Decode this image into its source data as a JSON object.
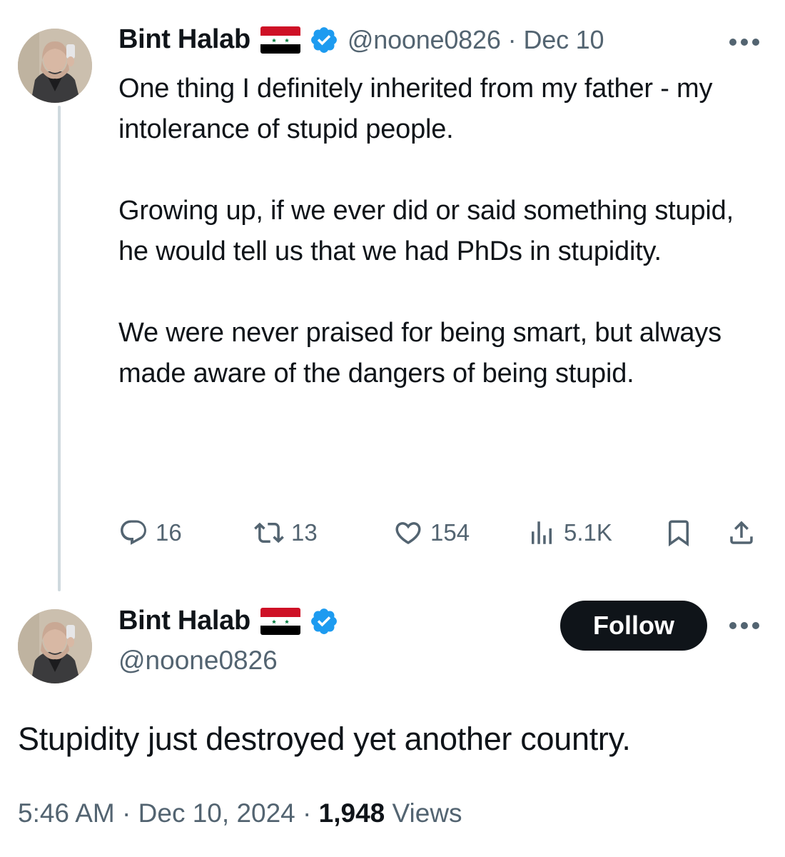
{
  "reply_tweet": {
    "author": {
      "display_name": "Bint Halab",
      "flag_icon": "syria-flag-icon",
      "verified_icon": "verified-badge-icon",
      "handle": "@noone0826"
    },
    "separator": "·",
    "date": "Dec 10",
    "more_icon": "more-horizontal-icon",
    "text_paragraphs": [
      "One thing I definitely inherited from my father - my intolerance of stupid people.",
      "Growing up, if we ever did or said something stupid, he would tell us that we had PhDs in stupidity.",
      "We were never praised for being smart, but always made aware of the dangers of being stupid."
    ],
    "actions": {
      "replies": "16",
      "reposts": "13",
      "likes": "154",
      "views": "5.1K"
    }
  },
  "main_tweet": {
    "author": {
      "display_name": "Bint Halab",
      "handle": "@noone0826"
    },
    "follow_label": "Follow",
    "text": "Stupidity just destroyed yet another country.",
    "meta": {
      "time": "5:46 AM",
      "separator": "·",
      "date": "Dec 10, 2024",
      "views_count": "1,948",
      "views_label": "Views"
    }
  },
  "colors": {
    "text_primary": "#0f1419",
    "text_secondary": "#536471",
    "verified_blue": "#1d9bf0",
    "thread_line": "#cfd9de",
    "follow_bg": "#0f1419",
    "flag_red": "#ce1126",
    "flag_green": "#007a3d"
  }
}
